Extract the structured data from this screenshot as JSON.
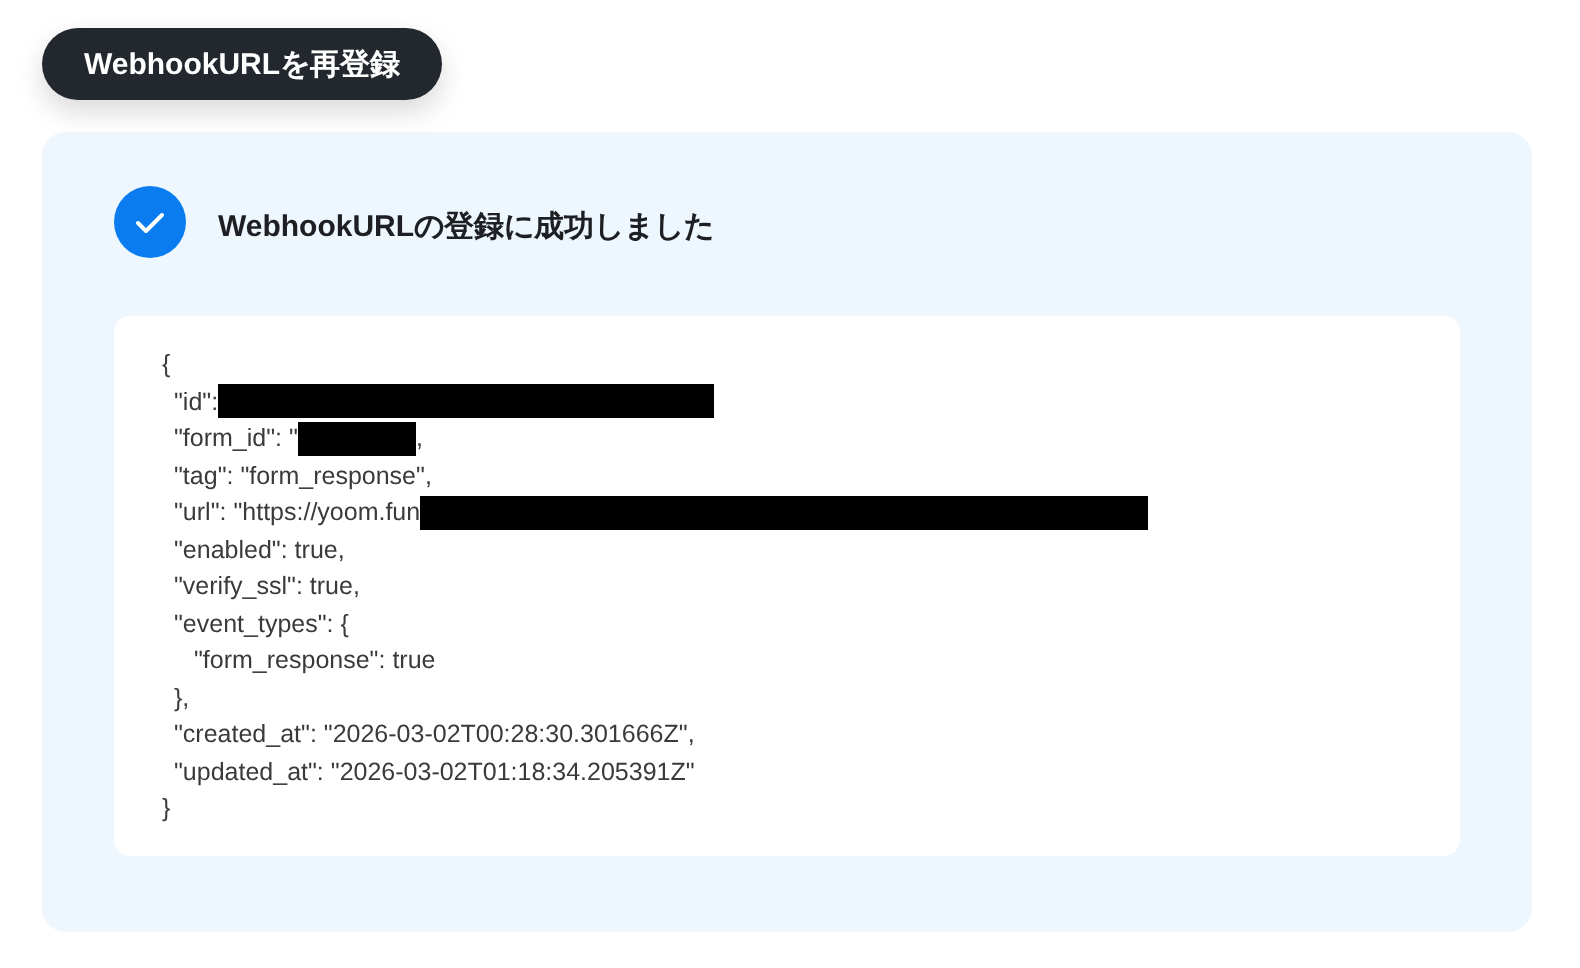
{
  "reregister_button": {
    "label": "WebhookURLを再登録"
  },
  "result": {
    "message": "WebhookURLの登録に成功しました"
  },
  "response_lines": [
    {
      "parts": [
        {
          "kind": "text",
          "text": "{"
        }
      ],
      "children": [
        {
          "parts": [
            {
              "kind": "text",
              "text": "\"id\":"
            },
            {
              "kind": "redaction"
            }
          ]
        },
        {
          "parts": [
            {
              "kind": "text",
              "text": "\"form_id\": \""
            },
            {
              "kind": "stub"
            },
            {
              "kind": "text",
              "text": ","
            }
          ]
        },
        {
          "parts": [
            {
              "kind": "text",
              "text": "\"tag\": \"form_response\","
            }
          ]
        },
        {
          "parts": [
            {
              "kind": "text",
              "text": "\"url\": \"https://yoom.fun"
            },
            {
              "kind": "band"
            }
          ]
        },
        {
          "parts": [
            {
              "kind": "text",
              "text": "\"enabled\": true,"
            }
          ]
        },
        {
          "parts": [
            {
              "kind": "text",
              "text": "\"verify_ssl\": true,"
            }
          ]
        },
        {
          "parts": [
            {
              "kind": "text",
              "text": "\"event_types\": {"
            }
          ],
          "children": [
            {
              "parts": [
                {
                  "kind": "text",
                  "text": "\"form_response\": true"
                }
              ]
            }
          ]
        },
        {
          "parts": [
            {
              "kind": "text",
              "text": "},"
            }
          ]
        },
        {
          "parts": [
            {
              "kind": "text",
              "text": "\"created_at\": \"2026-03-02T00:28:30.301666Z\","
            }
          ]
        },
        {
          "parts": [
            {
              "kind": "text",
              "text": "\"updated_at\": \"2026-03-02T01:18:34.205391Z\""
            }
          ]
        }
      ]
    },
    {
      "parts": [
        {
          "kind": "text",
          "text": "}"
        }
      ]
    }
  ]
}
